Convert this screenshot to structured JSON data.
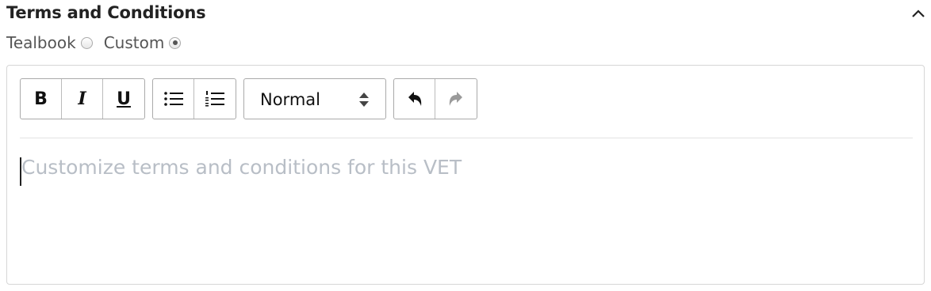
{
  "section": {
    "title": "Terms and Conditions",
    "collapse_icon": "chevron-up-icon"
  },
  "mode": {
    "options": [
      {
        "label": "Tealbook",
        "selected": false
      },
      {
        "label": "Custom",
        "selected": true
      }
    ]
  },
  "editor": {
    "toolbar": {
      "bold_label": "B",
      "italic_label": "I",
      "underline_label": "U",
      "bullet_list_icon": "bullet-list-icon",
      "ordered_list_icon": "ordered-list-icon",
      "format_value": "Normal",
      "format_icon": "updown-caret-icon",
      "undo_icon": "undo-icon",
      "redo_icon": "redo-icon"
    },
    "placeholder": "Customize terms and conditions for this VET",
    "value": ""
  }
}
